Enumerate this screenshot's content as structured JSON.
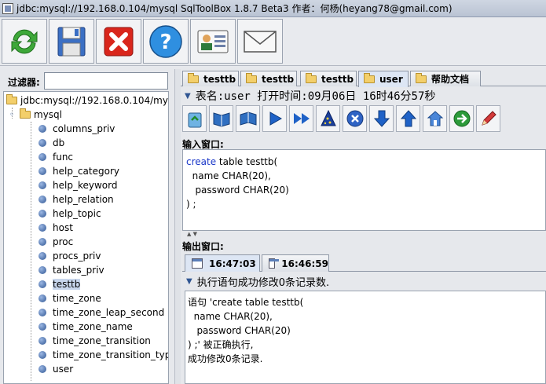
{
  "window": {
    "title": "jdbc:mysql://192.168.0.104/mysql SqlToolBox 1.8.7 Beta3  作者：何杨(heyang78@gmail.com)"
  },
  "toolbar": {
    "buttons": [
      {
        "name": "refresh-icon"
      },
      {
        "name": "save-icon"
      },
      {
        "name": "close-icon"
      },
      {
        "name": "help-icon"
      },
      {
        "name": "contact-card-icon"
      },
      {
        "name": "mail-icon"
      }
    ]
  },
  "filter": {
    "label": "过滤器:",
    "value": ""
  },
  "tree": {
    "root": "jdbc:mysql://192.168.0.104/mysql",
    "db": "mysql",
    "tables": [
      "columns_priv",
      "db",
      "func",
      "help_category",
      "help_keyword",
      "help_relation",
      "help_topic",
      "host",
      "proc",
      "procs_priv",
      "tables_priv",
      "testtb",
      "time_zone",
      "time_zone_leap_second",
      "time_zone_name",
      "time_zone_transition",
      "time_zone_transition_type",
      "user"
    ],
    "selected": "testtb"
  },
  "tabs": [
    "testtb",
    "testtb",
    "testtb",
    "user",
    "帮助文档"
  ],
  "active_tab": "user",
  "info": {
    "text": "表名:user 打开时间:09月06日 16时46分57秒"
  },
  "input": {
    "label": "输入窗口:",
    "line1_kw": "create",
    "line1_rest": " table testtb(",
    "line2": "  name CHAR(20),",
    "line3": "   password CHAR(20)",
    "line4": ") ;"
  },
  "output": {
    "label": "输出窗口:",
    "tabs": [
      "16:47:03",
      "16:46:59"
    ],
    "info": "执行语句成功修改0条记录数.",
    "lines": [
      "语句 'create table testtb(",
      "  name CHAR(20),",
      "   password CHAR(20)",
      ") ;' 被正确执行,",
      "成功修改0条记录."
    ]
  }
}
